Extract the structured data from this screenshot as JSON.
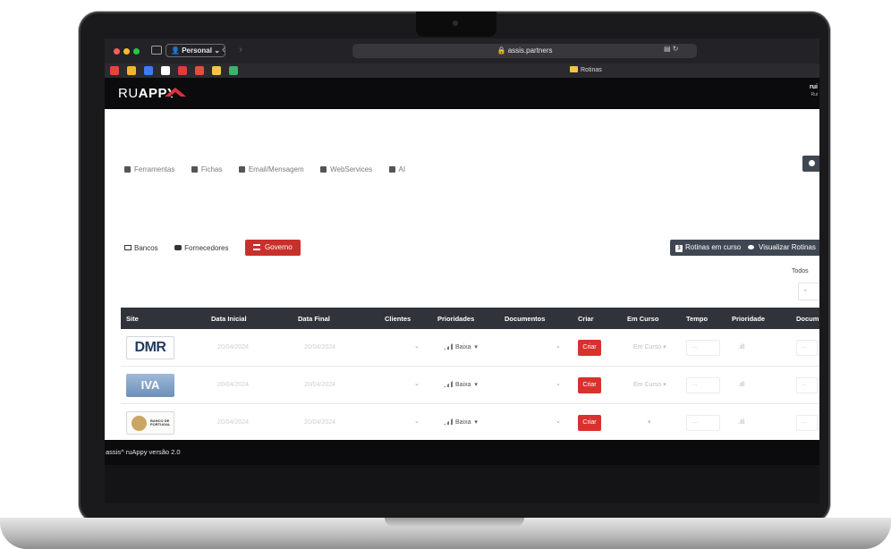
{
  "browser": {
    "profile": "Personal",
    "url": "assis.partners",
    "bookmark_folder": "Rotinas",
    "bookmark_colors": [
      "#e8443a",
      "#f2b530",
      "#3d7cf0",
      "#ffffff",
      "#e33a3a",
      "#e64c3c",
      "#f5c542",
      "#3ab36b"
    ]
  },
  "app": {
    "logo_light": "RU",
    "logo_bold": "APPY",
    "user_name": "rui",
    "user_sub": "Rui"
  },
  "top_nav": [
    {
      "label": "Ferramentas",
      "icon": "wrench-icon"
    },
    {
      "label": "Fichas",
      "icon": "file-icon"
    },
    {
      "label": "Email/Mensagem",
      "icon": "envelope-icon"
    },
    {
      "label": "WebServices",
      "icon": "cloud-icon"
    },
    {
      "label": "AI",
      "icon": "robot-icon"
    }
  ],
  "sub_nav": {
    "bancos": "Bancos",
    "fornecedores": "Fornecedores",
    "governo": "Governo"
  },
  "actions": {
    "rotinas_badge": "3",
    "rotinas_label": "Rotinas em curso",
    "visualizar_label": "Visualizar Rotinas"
  },
  "filter": {
    "label": "Todos",
    "placeholder": "+"
  },
  "table": {
    "headers": [
      "Site",
      "Data Inicial",
      "Data Final",
      "Clientes",
      "Prioridades",
      "Documentos",
      "Criar",
      "Em Curso",
      "Tempo",
      "Prioridade",
      "Docum"
    ],
    "rows": [
      {
        "site": "DMR",
        "site_logo": "dmr-logo",
        "data_inicial": "20/04/2024",
        "data_final": "20/04/2024",
        "prioridade": "Baixa",
        "criar": "Criar",
        "em_curso": "Em Curso",
        "tempo": "...",
        "documentos": "..."
      },
      {
        "site": "IVA",
        "site_logo": "iva-logo",
        "data_inicial": "20/04/2024",
        "data_final": "20/04/2024",
        "prioridade": "Baixa",
        "criar": "Criar",
        "em_curso": "Em Curso",
        "tempo": "...",
        "documentos": "..."
      },
      {
        "site": "BANCO DE PORTUGAL",
        "site_logo": "banco-de-portugal-logo",
        "data_inicial": "20/04/2024",
        "data_final": "20/04/2024",
        "prioridade": "Baixa",
        "criar": "Criar",
        "em_curso": "",
        "tempo": "...",
        "documentos": "..."
      }
    ]
  },
  "footer": {
    "text": "assis^ ruAppy versão 2.0"
  }
}
